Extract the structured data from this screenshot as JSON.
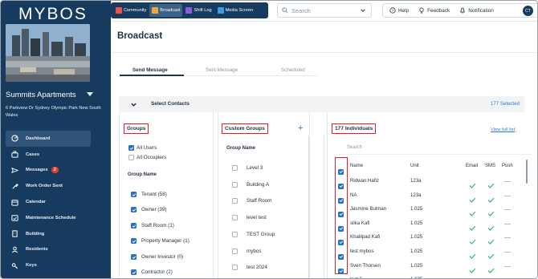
{
  "app": {
    "logo": "MYBOS"
  },
  "building": {
    "name": "Summits Apartments",
    "address": "6 Parkview Dr Sydney Olympic Park New South Wales"
  },
  "sidebar": {
    "items": [
      {
        "label": "Dashboard",
        "icon": "dashboard-icon",
        "active": true
      },
      {
        "label": "Cases",
        "icon": "cases-icon"
      },
      {
        "label": "Messages",
        "icon": "messages-icon",
        "badge": "2"
      },
      {
        "label": "Work Order Sent",
        "icon": "work-order-icon"
      },
      {
        "label": "Calendar",
        "icon": "calendar-icon"
      },
      {
        "label": "Maintenance Schedule",
        "icon": "maintenance-icon"
      },
      {
        "label": "Building",
        "icon": "building-icon"
      },
      {
        "label": "Residents",
        "icon": "residents-icon"
      },
      {
        "label": "Keys",
        "icon": "keys-icon"
      }
    ]
  },
  "topbar": {
    "tabs": [
      "Community",
      "Broadcast",
      "Shift Log",
      "Media Screen"
    ],
    "search_placeholder": "Search",
    "help": "Help",
    "feedback": "Feedback",
    "notification": "Notification",
    "avatar": "CT"
  },
  "page": {
    "title": "Broadcast",
    "tabs": [
      "Send Message",
      "Sent Message",
      "Scheduled"
    ],
    "select_contacts": "Select Contacts",
    "selected_count": "177 Selected"
  },
  "groups": {
    "heading": "Groups",
    "all_users": "All Users",
    "all_occupiers": "All Occupiers",
    "group_name_header": "Group Name",
    "items": [
      "Tenant (58)",
      "Owner (39)",
      "Staff Room (1)",
      "Property Manager (1)",
      "Owner Investor (0)",
      "Contractor (2)"
    ]
  },
  "custom_groups": {
    "heading": "Custom Groups",
    "add": "+",
    "group_name_header": "Group Name",
    "items": [
      "Level 3",
      "Building A",
      "Staff Room",
      "level test",
      "TEST Group",
      "mybos",
      "test 2024"
    ]
  },
  "individuals": {
    "heading": "177 Individuals",
    "view_full_list": "View full list",
    "search_placeholder": "Search",
    "columns": {
      "name": "Name",
      "unit": "Unit",
      "email": "Email",
      "sms": "SMS",
      "push": "Push"
    },
    "rows": [
      {
        "name": "Ridwan Hafiz",
        "unit": "123a"
      },
      {
        "name": "NA",
        "unit": "123a"
      },
      {
        "name": "Jasmine Bulman",
        "unit": "1.025"
      },
      {
        "name": "silka Kafi",
        "unit": "1.025"
      },
      {
        "name": "Khalilpad Kafi",
        "unit": "1.025"
      },
      {
        "name": "test mybos",
        "unit": "1.025"
      },
      {
        "name": "Sven Thorsen",
        "unit": "1.025"
      },
      {
        "name": "test 2",
        "unit": "1.025"
      }
    ]
  },
  "colors": {
    "sidebar": "#163b5e",
    "accent": "#2a70c7",
    "highlight": "#e21e26",
    "check": "#3fbf74"
  }
}
